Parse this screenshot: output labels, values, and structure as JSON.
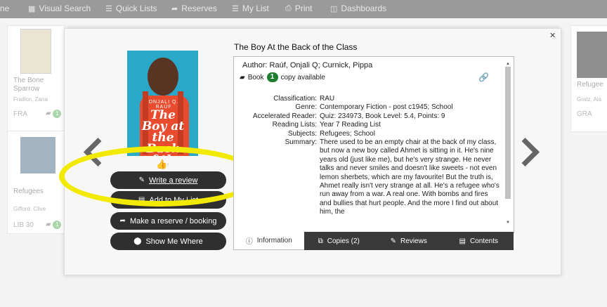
{
  "nav": {
    "items": [
      {
        "icon": "grid-icon",
        "label": "Visual Search"
      },
      {
        "icon": "list-icon",
        "label": "Quick Lists"
      },
      {
        "icon": "share-icon",
        "label": "Reserves"
      },
      {
        "icon": "list-icon",
        "label": "My List"
      },
      {
        "icon": "print-icon",
        "label": "Print"
      },
      {
        "icon": "dashboard-icon",
        "label": "Dashboards"
      }
    ],
    "fragment": "ne"
  },
  "background": {
    "card1": {
      "title": "The Bone Sparrow",
      "author": "Fraillon, Zana",
      "code": "FRA",
      "count": "1"
    },
    "card2": {
      "title": "Refugees",
      "author": "Gifford, Clive",
      "code": "LIB 30",
      "count": "1"
    },
    "card3": {
      "title": "Refugee",
      "author": "Gratz, Ala",
      "code": "GRA"
    }
  },
  "book": {
    "title": "The Boy At the Back of the Class",
    "author_label": "Author:",
    "author": "Raúf, Onjali Q; Curnick, Pippa",
    "format": "Book",
    "copies_available": "1",
    "copies_text": "copy available",
    "cover": {
      "title": "The Boy at the Back of the Class",
      "author": "ONJALI Q. RAÚF"
    },
    "likes": "-",
    "details": [
      {
        "label": "Classification:",
        "value": "RAU"
      },
      {
        "label": "Genre:",
        "value": "Contemporary Fiction - post c1945; School"
      },
      {
        "label": "Accelerated Reader:",
        "value": "Quiz: 234973, Book Level: 5.4, Points: 9"
      },
      {
        "label": "Reading Lists:",
        "value": "Year 7 Reading List"
      },
      {
        "label": "Subjects:",
        "value": "Refugees; School"
      },
      {
        "label": "Summary:",
        "value": "There used to be an empty chair at the back of my class, but now a new boy called Ahmet is sitting in it. He's nine years old (just like me), but he's very strange. He never talks and never smiles and doesn't like sweets - not even lemon sherbets, which are my favourite! But the truth is, Ahmet really isn't very strange at all. He's a refugee who's run away from a war. A real one. With bombs and fires and bullies that hurt people. And the more I find out about him, the"
      }
    ]
  },
  "actions": {
    "review": "Write a review",
    "add_list": "Add to My List",
    "reserve": "Make a reserve / booking",
    "show_where": "Show Me Where"
  },
  "tabs": [
    {
      "icon": "info-icon",
      "label": "Information"
    },
    {
      "icon": "copies-icon",
      "label": "Copies (2)"
    },
    {
      "icon": "edit-icon",
      "label": "Reviews"
    },
    {
      "icon": "document-icon",
      "label": "Contents"
    }
  ],
  "colors": {
    "highlight": "#f2ea00",
    "badge": "#1e7d2f",
    "button": "#2f2f2f"
  }
}
